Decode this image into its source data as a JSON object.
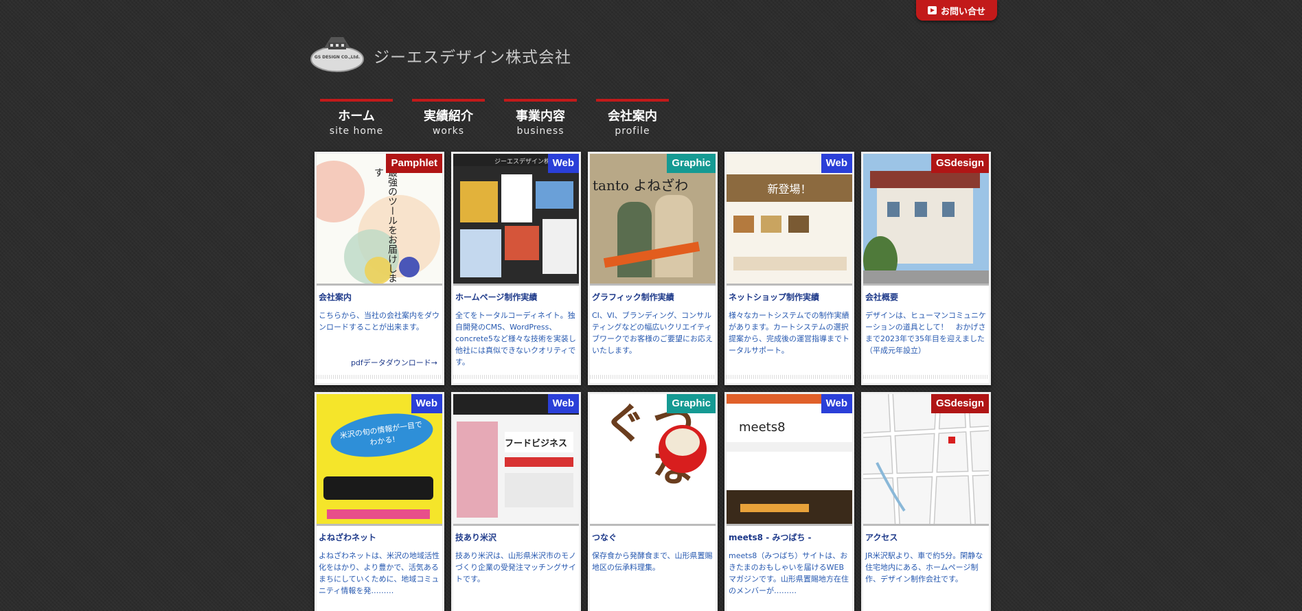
{
  "header": {
    "contact_label": "お問い合せ",
    "company_name": "ジーエスデザイン株式会社",
    "logo_text": "GS DESIGN CO.,Ltd."
  },
  "nav": [
    {
      "jp": "ホーム",
      "en": "site home"
    },
    {
      "jp": "実績紹介",
      "en": "works"
    },
    {
      "jp": "事業内容",
      "en": "business"
    },
    {
      "jp": "会社案内",
      "en": "profile"
    }
  ],
  "cards": [
    {
      "badge": "Pamphlet",
      "title": "会社案内",
      "desc": "こちらから、当社の会社案内をダウンロードすることが出来ます。",
      "link": "pdfデータダウンロード→",
      "thumb_text": "最強のツールをお届けします"
    },
    {
      "badge": "Web",
      "title": "ホームページ制作実績",
      "desc": "全てをトータルコーディネイト。独自開発のCMS、WordPress、concrete5など様々な技術を実装し他社には真似できないクオリティです。",
      "thumb_text": "ジーエスデザイン株式会社"
    },
    {
      "badge": "Graphic",
      "title": "グラフィック制作実績",
      "desc": "CI、VI、ブランディング、コンサルティングなどの幅広いクリエイティブワークでお客様のご要望にお応えいたします。",
      "thumb_text": "tanto よねざわ"
    },
    {
      "badge": "Web",
      "title": "ネットショップ制作実績",
      "desc": "様々なカートシステムでの制作実績があります。カートシステムの選択提案から、完成後の運営指導までトータルサポート。",
      "thumb_text": "新登場！"
    },
    {
      "badge": "GSdesign",
      "title": "会社概要",
      "desc": "デザインは、ヒューマンコミュニケーションの道具として！　おかげさまで2023年で35年目を迎えました（平成元年設立）"
    },
    {
      "badge": "Web",
      "title": "よねざわネット",
      "desc": "よねざわネットは、米沢の地域活性化をはかり、より豊かで、活気あるまちにしていくために、地域コミュニティ情報を発………",
      "thumb_text": "米沢の旬の情報が一目でわかる!"
    },
    {
      "badge": "Web",
      "title": "技あり米沢",
      "desc": "技あり米沢は、山形県米沢市のモノづくり企業の受発注マッチングサイトです。",
      "thumb_text": "フードビジネス"
    },
    {
      "badge": "Graphic",
      "title": "つなぐ",
      "desc": "保存食から発酵食まで、山形県置賜地区の伝承料理集。",
      "thumb_text": "つなぐ"
    },
    {
      "badge": "Web",
      "title": "meets8 - みつばち -",
      "desc": "meets8（みつばち）サイトは、おきたまのおもしゃいを届けるWEBマガジンです。山形県置賜地方在住のメンバーが………",
      "thumb_text": "meets8"
    },
    {
      "badge": "GSdesign",
      "title": "アクセス",
      "desc": "JR米沢駅より、車で約5分。閑静な住宅地内にある、ホームページ制作、デザイン制作会社です。"
    }
  ],
  "colors": {
    "accent": "#c21a1a",
    "web_badge": "#2a3fd8",
    "graphic_badge": "#159a93",
    "link": "#1e3a8a"
  }
}
